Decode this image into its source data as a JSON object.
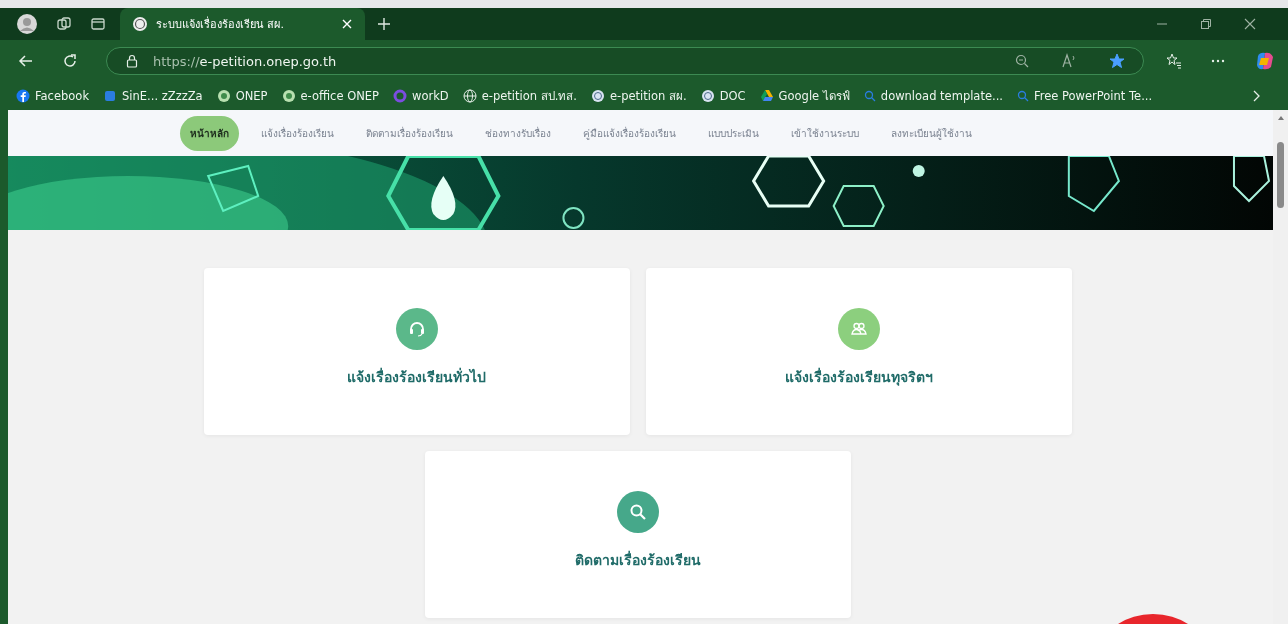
{
  "browser": {
    "tab": {
      "title": "ระบบแจ้งเรื่องร้องเรียน สผ."
    },
    "address": {
      "url_prefix": "https://",
      "url_host": "e-petition.onep.go.th"
    },
    "favorited": true,
    "bookmarks": [
      {
        "label": "Facebook",
        "kind": "facebook"
      },
      {
        "label": "SinE... zZzzZa",
        "kind": "app"
      },
      {
        "label": "ONEP",
        "kind": "emblem"
      },
      {
        "label": "e-office ONEP",
        "kind": "emblem"
      },
      {
        "label": "workD",
        "kind": "ring"
      },
      {
        "label": "e-petition สป.ทส.",
        "kind": "globe"
      },
      {
        "label": "e-petition สผ.",
        "kind": "seal"
      },
      {
        "label": "DOC",
        "kind": "seal"
      },
      {
        "label": "Google ไดรฟ์",
        "kind": "drive"
      },
      {
        "label": "download template...",
        "kind": "search"
      },
      {
        "label": "Free PowerPoint Te...",
        "kind": "search"
      }
    ]
  },
  "nav": [
    {
      "label": "หน้าหลัก",
      "selected": true
    },
    {
      "label": "แจ้งเรื่องร้องเรียน",
      "selected": false
    },
    {
      "label": "ติดตามเรื่องร้องเรียน",
      "selected": false
    },
    {
      "label": "ช่องทางรับเรื่อง",
      "selected": false
    },
    {
      "label": "คู่มือแจ้งเรื่องร้องเรียน",
      "selected": false
    },
    {
      "label": "แบบประเมิน",
      "selected": false
    },
    {
      "label": "เข้าใช้งานระบบ",
      "selected": false
    },
    {
      "label": "ลงทะเบียนผู้ใช้งาน",
      "selected": false
    }
  ],
  "cards": [
    {
      "title": "แจ้งเรื่องร้องเรียนทั่วไป",
      "kind": "headset",
      "color": "#5bb88a"
    },
    {
      "title": "แจ้งเรื่องร้องเรียนทุจริตฯ",
      "kind": "people",
      "color": "#8ccf7e"
    },
    {
      "title": "ติดตามเรื่องร้องเรียน",
      "kind": "search",
      "color": "#46a88a"
    }
  ]
}
